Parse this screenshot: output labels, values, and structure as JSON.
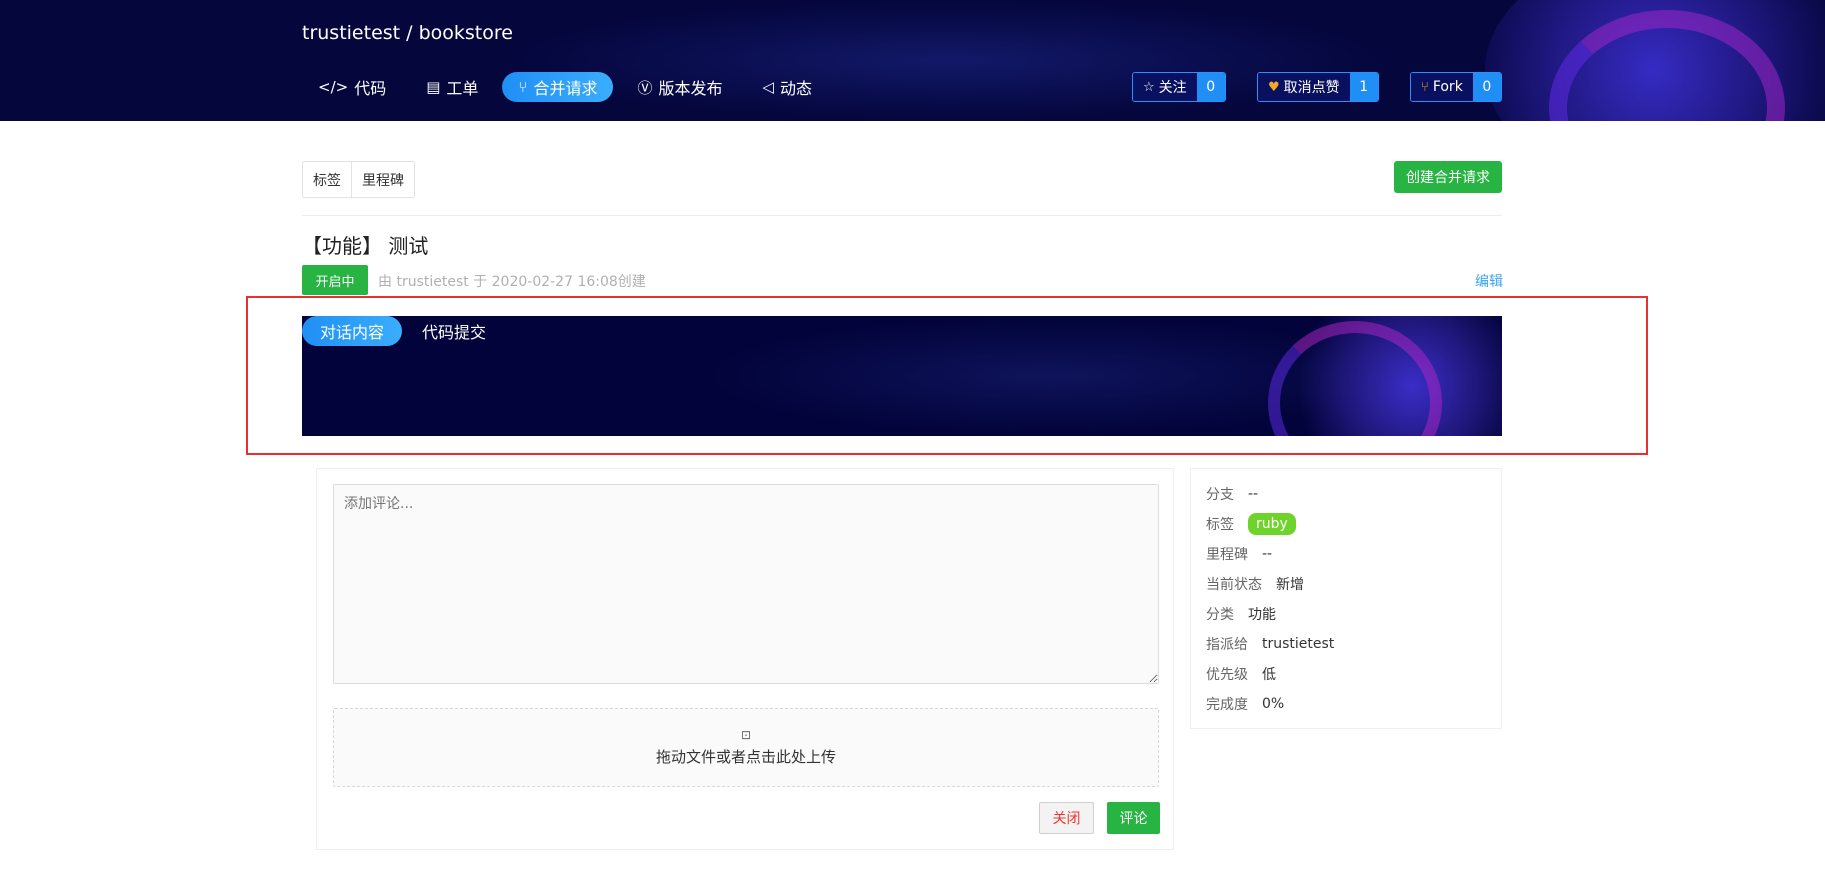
{
  "header": {
    "repo_title": "trustietest / bookstore",
    "nav": [
      {
        "label": "代码",
        "icon": "code-icon",
        "glyph": "</>"
      },
      {
        "label": "工单",
        "icon": "clipboard-icon",
        "glyph": "▤"
      },
      {
        "label": "合并请求",
        "icon": "merge-icon",
        "glyph": "⑂"
      },
      {
        "label": "版本发布",
        "icon": "version-icon",
        "glyph": "Ⓥ"
      },
      {
        "label": "动态",
        "icon": "speaker-icon",
        "glyph": "◁"
      }
    ],
    "active_nav": "合并请求",
    "stats": {
      "watch": {
        "label": "关注",
        "count": "0",
        "icon": "star-icon",
        "glyph": "☆"
      },
      "like": {
        "label": "取消点赞",
        "count": "1",
        "icon": "heart-icon",
        "glyph": "♥"
      },
      "fork": {
        "label": "Fork",
        "count": "0",
        "icon": "fork-icon",
        "glyph": "⑂"
      }
    },
    "accent_color": "#1f8ff5"
  },
  "subtabs": [
    "标签",
    "里程碑"
  ],
  "create_button": "创建合并请求",
  "issue": {
    "title": "【功能】 测试",
    "status": "开启中",
    "meta": "由 trustietest 于 2020-02-27 16:08创建",
    "edit": "编辑"
  },
  "conversation_tabs": [
    "对话内容",
    "代码提交"
  ],
  "active_conversation_tab": "对话内容",
  "comment": {
    "placeholder": "添加评论...",
    "upload_text": "拖动文件或者点击此处上传",
    "close_button": "关闭",
    "comment_button": "评论"
  },
  "sidebar": {
    "rows": [
      {
        "label": "分支",
        "value": "--"
      },
      {
        "label": "标签",
        "value": "ruby"
      },
      {
        "label": "里程碑",
        "value": "--"
      },
      {
        "label": "当前状态",
        "value": "新增"
      },
      {
        "label": "分类",
        "value": "功能"
      },
      {
        "label": "指派给",
        "value": "trustietest"
      },
      {
        "label": "优先级",
        "value": "低"
      },
      {
        "label": "完成度",
        "value": "0%"
      }
    ],
    "tag_color": "#6ed42b"
  },
  "status_color": "#28b443"
}
